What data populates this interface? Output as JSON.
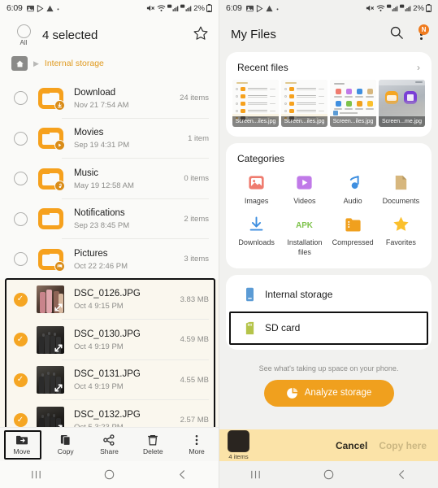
{
  "left": {
    "statusbar": {
      "time": "6:09",
      "icons": [
        "image-icon",
        "play-store-icon",
        "warning-icon",
        "dot-icon"
      ],
      "right_icons": [
        "mute-icon",
        "wifi-icon",
        "signal-icon",
        "signal2-icon"
      ],
      "battery": "2%"
    },
    "header": {
      "all_label": "All",
      "title": "4 selected",
      "star_icon": "star-outline-icon"
    },
    "breadcrumb": {
      "home_icon": "home-icon",
      "arrow": "▶",
      "text": "Internal storage"
    },
    "rows": [
      {
        "type": "folder",
        "badge": "download",
        "name": "Download",
        "date": "Nov 21 7:54 AM",
        "right": "24 items",
        "selected": false
      },
      {
        "type": "folder",
        "badge": "video",
        "name": "Movies",
        "date": "Sep 19 4:31 PM",
        "right": "1 item",
        "selected": false
      },
      {
        "type": "folder",
        "badge": "music",
        "name": "Music",
        "date": "May 19 12:58 AM",
        "right": "0 items",
        "selected": false
      },
      {
        "type": "folder",
        "badge": "none",
        "name": "Notifications",
        "date": "Sep 23 8:45 PM",
        "right": "2 items",
        "selected": false
      },
      {
        "type": "folder",
        "badge": "image",
        "name": "Pictures",
        "date": "Oct 22 2:46 PM",
        "right": "3 items",
        "selected": false
      },
      {
        "type": "photo",
        "variant": 0,
        "name": "DSC_0126.JPG",
        "date": "Oct 4 9:15 PM",
        "right": "3.83 MB",
        "selected": true
      },
      {
        "type": "photo",
        "variant": 1,
        "name": "DSC_0130.JPG",
        "date": "Oct 4 9:19 PM",
        "right": "4.59 MB",
        "selected": true
      },
      {
        "type": "photo",
        "variant": 2,
        "name": "DSC_0131.JPG",
        "date": "Oct 4 9:19 PM",
        "right": "4.55 MB",
        "selected": true
      },
      {
        "type": "photo",
        "variant": 3,
        "name": "DSC_0132.JPG",
        "date": "Oct 5 3:23 PM",
        "right": "2.57 MB",
        "selected": true
      }
    ],
    "bottombar": [
      {
        "icon": "move-icon",
        "label": "Move",
        "highlighted": true
      },
      {
        "icon": "copy-icon",
        "label": "Copy",
        "highlighted": false
      },
      {
        "icon": "share-icon",
        "label": "Share",
        "highlighted": false
      },
      {
        "icon": "delete-icon",
        "label": "Delete",
        "highlighted": false
      },
      {
        "icon": "more-icon",
        "label": "More",
        "highlighted": false
      }
    ],
    "navbar": [
      "recents-icon",
      "home-icon",
      "back-icon"
    ]
  },
  "right": {
    "statusbar": {
      "time": "6:09",
      "battery": "2%"
    },
    "header": {
      "title": "My Files",
      "search_icon": "search-icon",
      "menu_icon": "kebab-menu-icon",
      "badge": "N"
    },
    "recent": {
      "title": "Recent files",
      "chevron": "›",
      "items": [
        {
          "label": "Screen...iles.jpg",
          "kind": "filelist"
        },
        {
          "label": "Screen...iles.jpg",
          "kind": "filelist"
        },
        {
          "label": "Screen...iles.jpg",
          "kind": "categories"
        },
        {
          "label": "Screen...me.jpg",
          "kind": "photo"
        }
      ]
    },
    "categories": {
      "title": "Categories",
      "items": [
        {
          "label": "Images",
          "icon": "image-icon",
          "color": "#ef7b6e"
        },
        {
          "label": "Videos",
          "icon": "video-icon",
          "color": "#c07ae8"
        },
        {
          "label": "Audio",
          "icon": "audio-icon",
          "color": "#3f8fe0"
        },
        {
          "label": "Documents",
          "icon": "document-icon",
          "color": "#d7b77e"
        },
        {
          "label": "Downloads",
          "icon": "download-icon",
          "color": "#3f8fe0"
        },
        {
          "label": "Installation files",
          "icon": "apk-icon",
          "color": "#7dc24a"
        },
        {
          "label": "Compressed",
          "icon": "compressed-icon",
          "color": "#f0a01e"
        },
        {
          "label": "Favorites",
          "icon": "star-filled-icon",
          "color": "#fbc02d"
        }
      ]
    },
    "storage": [
      {
        "label": "Internal storage",
        "icon": "internal-storage-icon",
        "color": "#5b9bd5",
        "highlighted": false
      },
      {
        "label": "SD card",
        "icon": "sd-card-icon",
        "color": "#b5c44a",
        "highlighted": true
      }
    ],
    "analyze": {
      "note": "See what's taking up space on your phone.",
      "button_label": "Analyze storage",
      "button_icon": "pie-chart-icon",
      "button_color": "#f0a01e"
    },
    "copybar": {
      "count": "4 items",
      "cancel_label": "Cancel",
      "copy_label": "Copy here",
      "background": "#fbe3a8"
    },
    "navbar": [
      "recents-icon",
      "home-icon",
      "back-icon"
    ]
  }
}
